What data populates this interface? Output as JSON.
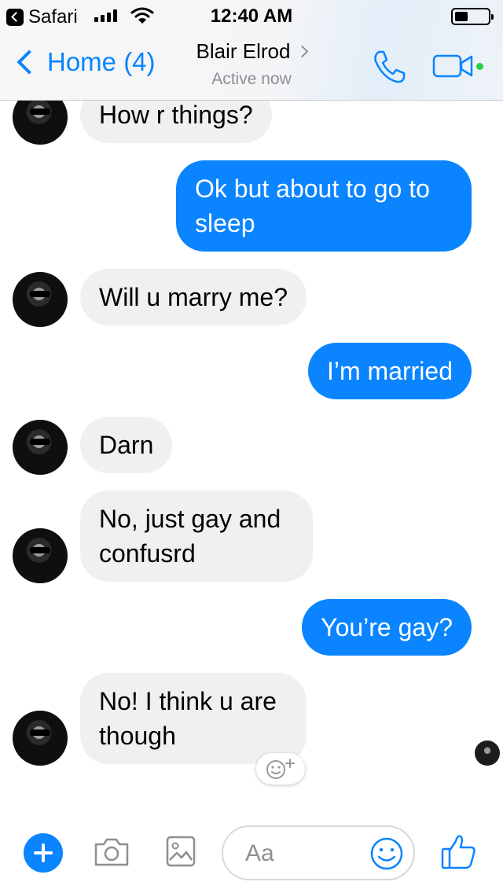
{
  "status_bar": {
    "back_app": "Safari",
    "time": "12:40 AM"
  },
  "nav": {
    "back_label": "Home (4)",
    "contact_name": "Blair Elrod",
    "contact_status": "Active now"
  },
  "messages": [
    {
      "side": "in",
      "text": "How r things?"
    },
    {
      "side": "out",
      "text": "Ok but about to go to sleep"
    },
    {
      "side": "in",
      "text": "Will u marry me?"
    },
    {
      "side": "out",
      "text": "I’m married"
    },
    {
      "side": "in",
      "text": "Darn"
    },
    {
      "side": "in",
      "text": "No, just gay and confusrd"
    },
    {
      "side": "out",
      "text": "You’re gay?"
    },
    {
      "side": "in",
      "text": "No! I think u are though"
    }
  ],
  "composer": {
    "placeholder": "Aa"
  },
  "colors": {
    "accent": "#0a84ff",
    "incoming_bubble": "#f0f0f0",
    "online": "#2bd145"
  },
  "icons": {
    "back_app": "chevron-left-icon",
    "signal": "cellular-signal-icon",
    "wifi": "wifi-icon",
    "battery": "battery-icon",
    "call": "phone-icon",
    "video": "video-camera-icon",
    "add": "plus-icon",
    "camera": "camera-icon",
    "gallery": "image-icon",
    "emoji": "smiley-icon",
    "like": "thumbs-up-icon",
    "react": "add-reaction-icon"
  }
}
